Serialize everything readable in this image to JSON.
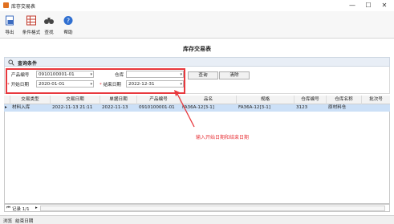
{
  "window": {
    "title": "库存交易表",
    "minimize": "—",
    "maximize": "☐",
    "close": "✕"
  },
  "toolbar": {
    "export_label": "导出",
    "format_label": "条件格式",
    "find_label": "查找",
    "help_label": "帮助"
  },
  "report_title": "库存交易表",
  "conditions": {
    "header": "查询条件",
    "product_no_label": "产品编号",
    "product_no_value": "0910100001-01",
    "warehouse_label": "仓库",
    "warehouse_value": "",
    "start_date_label": "开始日期",
    "start_date_value": "2020-01-01",
    "end_date_label": "结束日期",
    "end_date_value": "2022-12-31",
    "query_button": "查询",
    "clear_button": "清除"
  },
  "table": {
    "columns": [
      "交易类型",
      "交易日期",
      "单据日期",
      "产品编号",
      "品名",
      "规格",
      "仓库编号",
      "仓库名称",
      "批次号"
    ],
    "rows": [
      [
        "材料入库",
        "2022-11-13 21:11",
        "2022-11-13",
        "0910100001-01",
        "FA36A-12[3-1]",
        "FA36A-12[3-1]",
        "3123",
        "原材料仓",
        ""
      ]
    ]
  },
  "annotation": "输入开始日期和结束日期",
  "navigator": {
    "record_text": "记录 1/1"
  },
  "status": {
    "browse": "浏览",
    "end_date": "结束日期"
  },
  "colors": {
    "highlight": "#e8383d",
    "selected_row": "#cce0f7"
  }
}
